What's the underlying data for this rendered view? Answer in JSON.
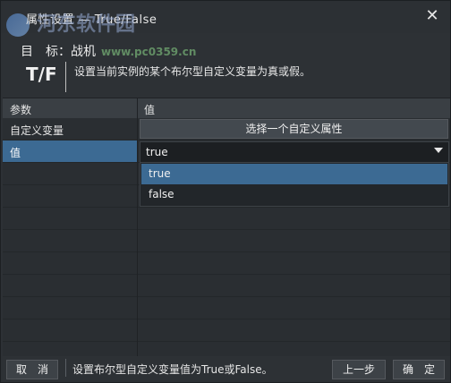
{
  "titlebar": {
    "title": "属性设置 — True/False",
    "watermark": "河东软件园",
    "watermark_url": "www.pc0359.cn",
    "close_icon": "close-icon"
  },
  "header": {
    "target": "目　标：战机",
    "tf_icon_text": "T/F",
    "description": "设置当前实例的某个布尔型自定义变量为真或假。"
  },
  "table": {
    "col_param": "参数",
    "col_value": "值",
    "rows": [
      {
        "param": "自定义变量",
        "value": "选择一个自定义属性"
      },
      {
        "param": "值",
        "value": "true"
      }
    ]
  },
  "dropdown": {
    "options": [
      "true",
      "false"
    ],
    "selected": "true"
  },
  "footer": {
    "cancel": "取　消",
    "hint": "设置布尔型自定义变量值为True或False。",
    "prev": "上一步",
    "ok": "确　定"
  },
  "colors": {
    "selection": "#3c6a93",
    "background": "#2d3135"
  }
}
